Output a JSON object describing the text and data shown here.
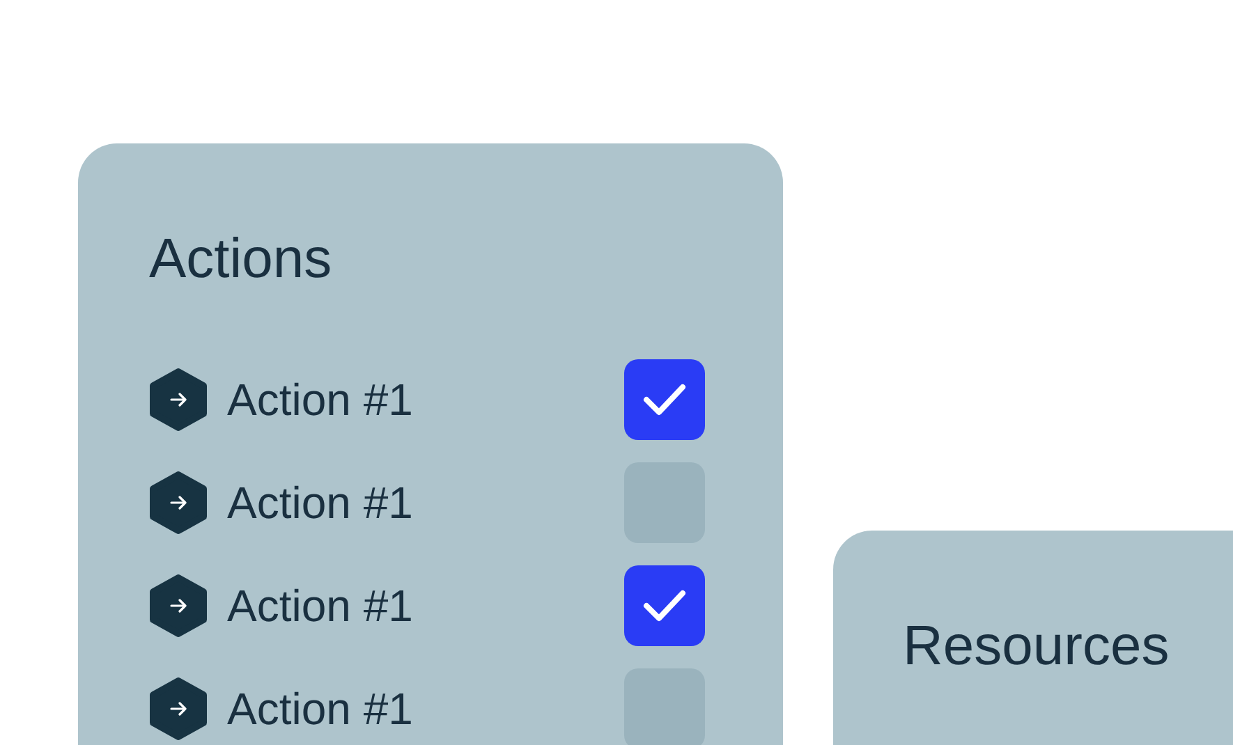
{
  "actions_card": {
    "title": "Actions",
    "items": [
      {
        "label": "Action #1",
        "checked": true
      },
      {
        "label": "Action #1",
        "checked": false
      },
      {
        "label": "Action #1",
        "checked": true
      },
      {
        "label": "Action #1",
        "checked": false
      }
    ]
  },
  "resources_card": {
    "title": "Resources"
  }
}
